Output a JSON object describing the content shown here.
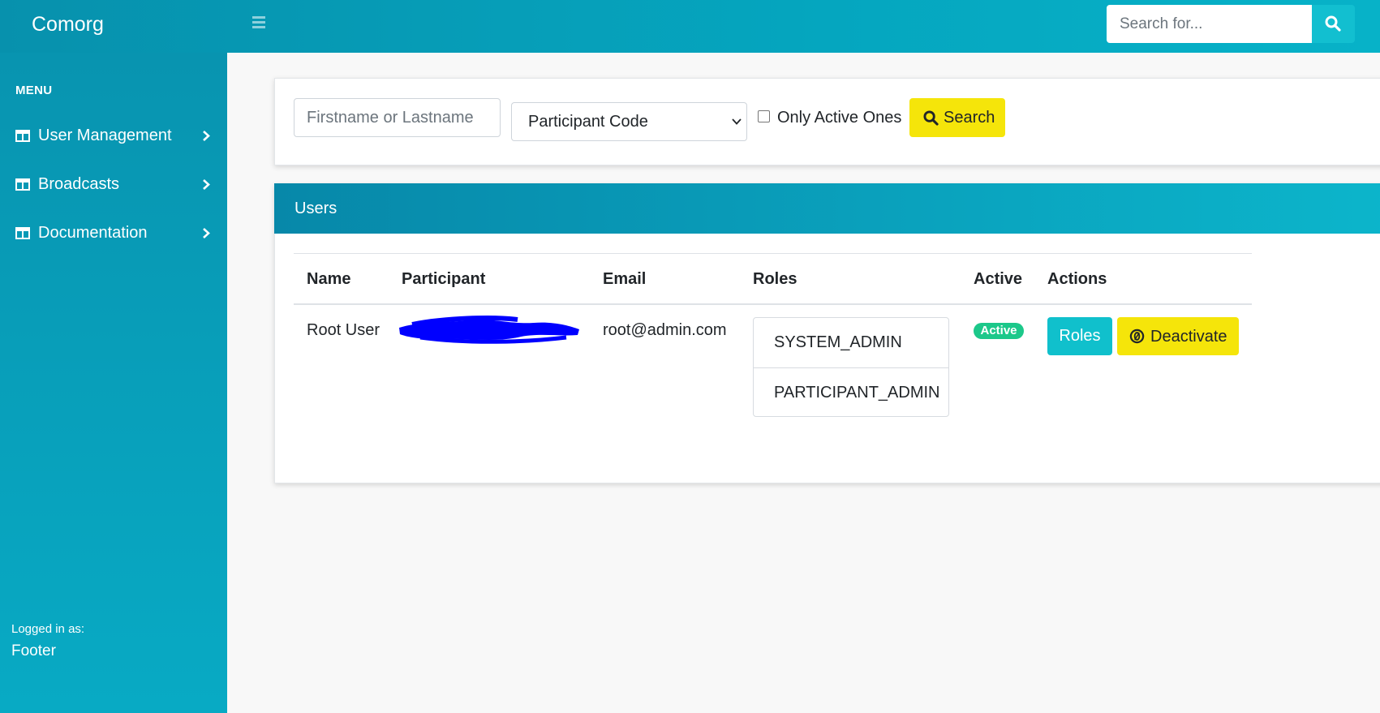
{
  "brand": "Comorg",
  "topbar": {
    "search_placeholder": "Search for..."
  },
  "sidebar": {
    "menu_title": "MENU",
    "items": [
      {
        "label": "User Management",
        "icon": "table-icon"
      },
      {
        "label": "Broadcasts",
        "icon": "table-icon"
      },
      {
        "label": "Documentation",
        "icon": "table-icon"
      }
    ],
    "logged_in_label": "Logged in as:",
    "footer": "Footer"
  },
  "filters": {
    "name_placeholder": "Firstname or Lastname",
    "participant_select": "Participant Code",
    "only_active_label": "Only Active Ones",
    "only_active_checked": false,
    "search_label": "Search"
  },
  "users": {
    "title": "Users",
    "columns": [
      "Name",
      "Participant",
      "Email",
      "Roles",
      "Active",
      "Actions"
    ],
    "rows": [
      {
        "name": "Root User",
        "participant": "",
        "email": "root@admin.com",
        "roles": [
          "SYSTEM_ADMIN",
          "PARTICIPANT_ADMIN"
        ],
        "active": "Active",
        "actions": {
          "roles": "Roles",
          "deactivate": "Deactivate"
        }
      }
    ]
  },
  "colors": {
    "primary": "#0aa3be",
    "warning": "#f5e50a",
    "info": "#10c0cc",
    "success": "#1cc88a",
    "redaction": "#0000ff"
  }
}
